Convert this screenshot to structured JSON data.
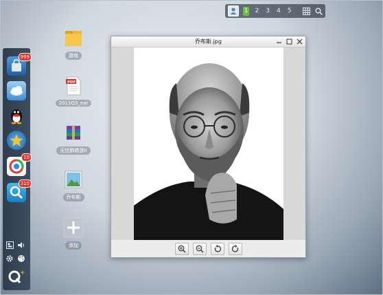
{
  "topbar": {
    "pages": [
      "1",
      "2",
      "3",
      "4",
      "5"
    ],
    "active_page": "1",
    "icons": [
      "avatar-icon",
      "grid-icon",
      "search-icon"
    ]
  },
  "dock": {
    "apps": [
      {
        "name": "app-store",
        "badge": "999"
      },
      {
        "name": "cloud-drive",
        "badge": ""
      },
      {
        "name": "qq",
        "badge": ""
      },
      {
        "name": "star-app",
        "badge": ""
      },
      {
        "name": "browser",
        "badge": "10"
      },
      {
        "name": "search-app",
        "badge": "310"
      }
    ],
    "bottom_icons": [
      "window-icon",
      "volume-icon",
      "settings-icon",
      "palette-icon",
      "qplus-logo"
    ]
  },
  "desktop": {
    "icons": [
      {
        "label": "游戏",
        "type": "folder"
      },
      {
        "label": "2011Q3_ear",
        "type": "pdf"
      },
      {
        "label": "无忧肺癌游II",
        "type": "archive"
      },
      {
        "label": "乔布斯",
        "type": "image"
      },
      {
        "label": "添加",
        "type": "add"
      }
    ]
  },
  "viewer": {
    "title": "乔布斯.jpg",
    "controls": [
      "minimize-icon",
      "maximize-icon",
      "close-icon"
    ],
    "tools": [
      "zoom-in-icon",
      "zoom-out-icon",
      "rotate-left-icon",
      "rotate-right-icon"
    ]
  },
  "colors": {
    "accent_green": "#6abf3b",
    "badge_red": "#e0332b",
    "dock_bg": "#2f3d4d"
  }
}
